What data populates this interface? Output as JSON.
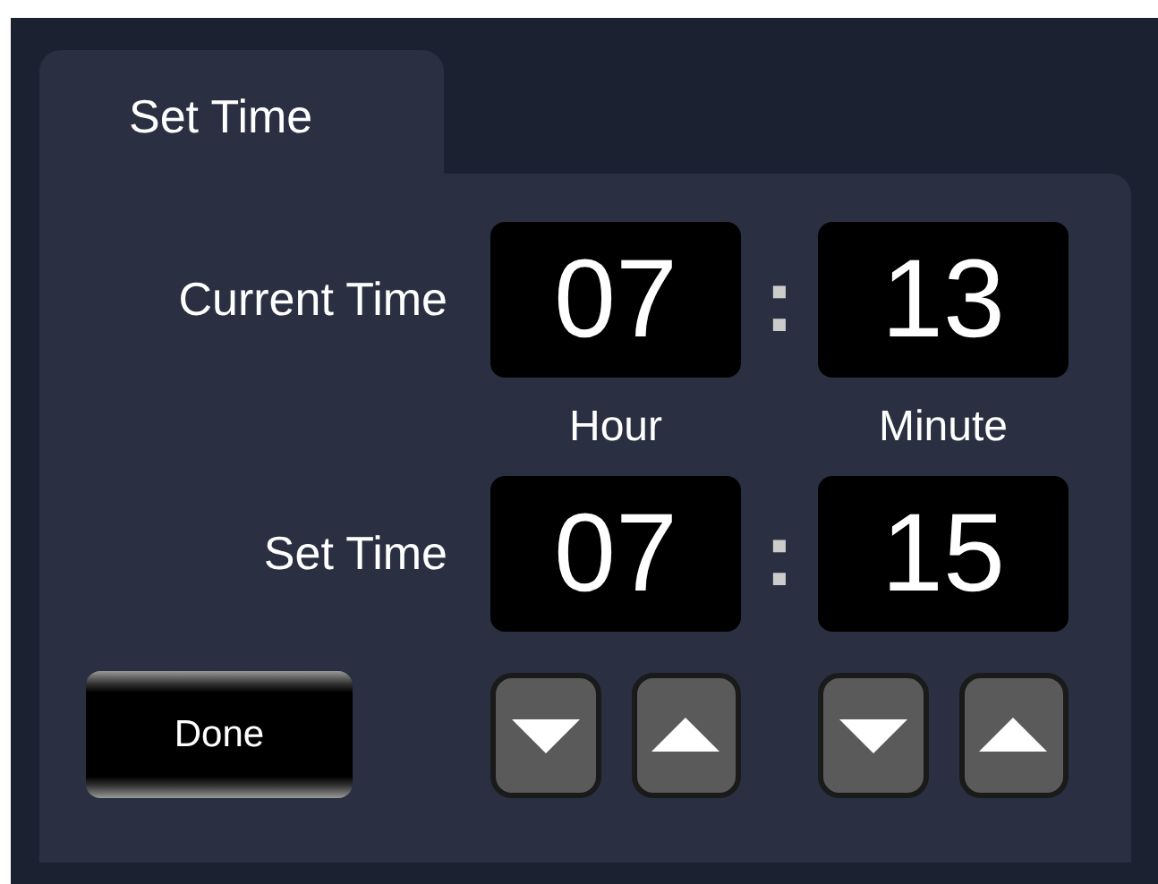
{
  "tabs": [
    {
      "label": "Set Time",
      "selected": true
    }
  ],
  "rows": [
    {
      "label": "Current Time",
      "hour": "07",
      "separator": ":",
      "minute": "13"
    },
    {
      "label": "Set Time",
      "hour": "07",
      "separator": ":",
      "minute": "15"
    }
  ],
  "units": [
    "Hour",
    "Minute"
  ],
  "done_button": "Done",
  "steppers": [
    {
      "kind": "down"
    },
    {
      "kind": "up"
    },
    {
      "kind": "down"
    },
    {
      "kind": "up"
    }
  ]
}
